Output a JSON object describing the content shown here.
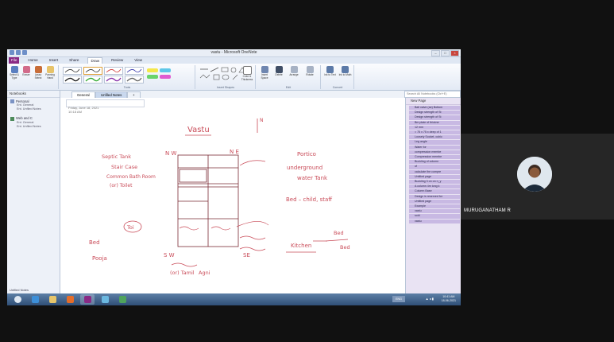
{
  "window": {
    "title": "vastu - Microsoft OneNote",
    "controls": [
      "–",
      "□",
      "×"
    ]
  },
  "ribbon": {
    "tabs": [
      "File",
      "Home",
      "Insert",
      "Share",
      "Draw",
      "Review",
      "View"
    ],
    "active_tab": "Draw",
    "tools": [
      {
        "label": "Select & Type"
      },
      {
        "label": "Eraser"
      },
      {
        "label": "Lasso Select"
      },
      {
        "label": "Panning Hand"
      }
    ],
    "groups": [
      "Tools",
      "Insert Shapes",
      "Edit",
      "Convert"
    ],
    "right_tools": [
      {
        "label": "Insert Space"
      },
      {
        "label": "Delete"
      },
      {
        "label": "Arrange"
      },
      {
        "label": "Rotate"
      },
      {
        "label": "Ink to Text"
      },
      {
        "label": "Ink to Math"
      },
      {
        "label": "Color & Thickness"
      }
    ]
  },
  "notebooks": {
    "header": "Notebooks",
    "items": [
      {
        "name": "Personal",
        "sections": [
          "Ent. General",
          "Ent. Unfiled Notes"
        ]
      },
      {
        "name": "Web and C",
        "sections": [
          "Ent. General",
          "Ent. Unfiled Notes"
        ]
      }
    ],
    "footer": "Unfiled Notes"
  },
  "sections": [
    "General",
    "Unfiled Notes",
    "+"
  ],
  "search": {
    "placeholder": "Search All Notebooks (Ctrl+E)"
  },
  "page": {
    "date": "Friday, June 18, 2021",
    "time": "10:18 AM",
    "handwriting": {
      "title": "Vastu",
      "north": "N",
      "nw": "N W",
      "ne": "N E",
      "sw": "S W",
      "se": "SE",
      "left1": "Septic Tank",
      "left2": "Stair Case",
      "left3": "Common Bath Room",
      "left4": "(or) Toilet",
      "circled": "Toi",
      "bed_left": "Bed",
      "pooja": "Pooja",
      "right1": "Portico",
      "right2": "underground",
      "right3": "water Tank",
      "right4": "Bed – child, staff",
      "kitchen": "Kitchen",
      "bed2": "Bed",
      "bed3": "Bed",
      "temil1": "(or) Tamil",
      "temil2": "Agni"
    }
  },
  "pages_pane": {
    "new_page": "New Page",
    "pages": [
      "Ball valve (ae) Bottom",
      "Design strength of St",
      "Design strength of St",
      "Bm plate of thickne",
      "12 mm",
      "= 75 x 75 x deep of 1",
      "Loosely Socket, cubic",
      "Leg angle",
      "Water for",
      "compression membe",
      "Compression membe",
      "Buckling of column",
      "of",
      "calculate the compre",
      "Untitled page",
      "Buckling 3 on on n_y",
      "A column 4m long k",
      "Column Base",
      "Design is reserved for",
      "Untitled page",
      "Example",
      "vastu",
      "sold",
      "vastu"
    ]
  },
  "taskbar": {
    "lang": "ENG",
    "time": "10:41 AM",
    "date": "18-06-2021"
  },
  "participant": {
    "name": "MURUGANATHAM R"
  },
  "colors": {
    "ink": "#c94b58",
    "ink_dark": "#7a2b35",
    "file_tab": "#8a2a85",
    "accent": "#2f4f77"
  }
}
